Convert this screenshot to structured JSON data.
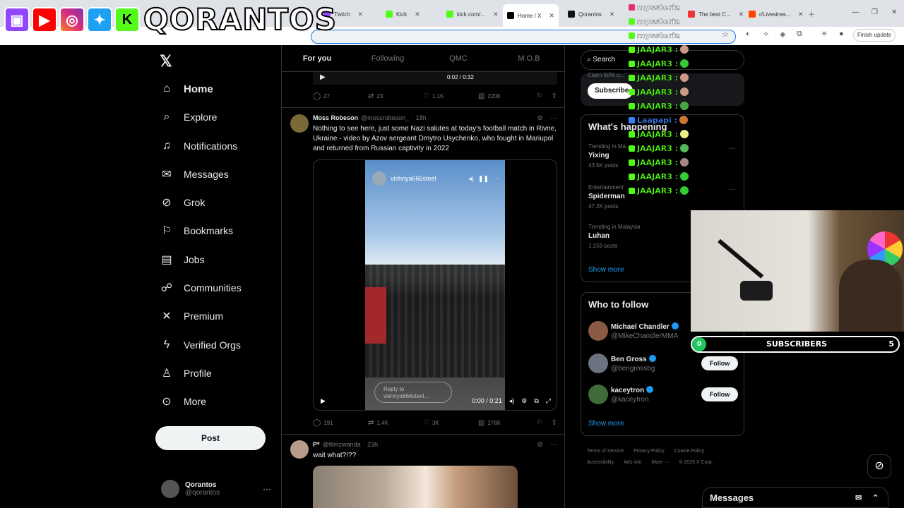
{
  "browser": {
    "tabs": [
      {
        "label": "Twitch",
        "color": "#9146ff"
      },
      {
        "label": "Kick",
        "color": "#53fc18"
      },
      {
        "label": "kick.com/...",
        "color": "#53fc18"
      },
      {
        "label": "Home / X",
        "color": "#000000",
        "active": true
      },
      {
        "label": "Qorantos",
        "color": "#111111"
      },
      {
        "label": "Instagram",
        "color": "#e1306c"
      },
      {
        "label": "The best C...",
        "color": "#e33"
      },
      {
        "label": "r/Livestrea...",
        "color": "#ff4500"
      }
    ],
    "finish_update": "Finish update"
  },
  "overlay": {
    "streamer_name": "QORANTOS",
    "logo_icons": [
      "twitch-icon",
      "youtube-icon",
      "instagram-icon",
      "twitter-icon",
      "kick-icon"
    ]
  },
  "chat": [
    {
      "user": "myssteria",
      "color": "#ffffff"
    },
    {
      "user": "myssteria",
      "color": "#ffffff"
    },
    {
      "user": "myssteria",
      "color": "#ffffff"
    },
    {
      "user": "JAAJAR3 :",
      "color": "#53fc18"
    },
    {
      "user": "JAAJAR3 :",
      "color": "#53fc18"
    },
    {
      "user": "JAAJAR3 :",
      "color": "#53fc18"
    },
    {
      "user": "JAAJAR3 :",
      "color": "#53fc18"
    },
    {
      "user": "JAAJAR3 :",
      "color": "#53fc18"
    },
    {
      "user": "Laapapi :",
      "color": "#3b82f6"
    },
    {
      "user": "JAAJAR3 :",
      "color": "#53fc18"
    },
    {
      "user": "JAAJAR3 :",
      "color": "#53fc18"
    },
    {
      "user": "JAAJAR3 :",
      "color": "#53fc18"
    },
    {
      "user": "JAAJAR3 :",
      "color": "#53fc18"
    },
    {
      "user": "JAAJAR3 :",
      "color": "#53fc18"
    }
  ],
  "nav": {
    "items": [
      {
        "label": "Home",
        "icon": "home-icon"
      },
      {
        "label": "Explore",
        "icon": "search-icon"
      },
      {
        "label": "Notifications",
        "icon": "bell-icon"
      },
      {
        "label": "Messages",
        "icon": "envelope-icon"
      },
      {
        "label": "Grok",
        "icon": "grok-icon"
      },
      {
        "label": "Bookmarks",
        "icon": "bookmark-icon"
      },
      {
        "label": "Jobs",
        "icon": "briefcase-icon"
      },
      {
        "label": "Communities",
        "icon": "people-icon"
      },
      {
        "label": "Premium",
        "icon": "x-icon"
      },
      {
        "label": "Verified Orgs",
        "icon": "lightning-icon"
      },
      {
        "label": "Profile",
        "icon": "person-icon"
      },
      {
        "label": "More",
        "icon": "more-circle-icon"
      }
    ],
    "post_label": "Post",
    "account": {
      "name": "Qorantos",
      "handle": "@qorantos"
    }
  },
  "feed": {
    "tabs": [
      "For you",
      "Following",
      "QMC",
      "M.O.B"
    ],
    "top_video_time": "0:02 / 0:32",
    "tweet0_stats": {
      "replies": "27",
      "reposts": "23",
      "likes": "1.1K",
      "views": "220K"
    },
    "tweet1": {
      "name": "Moss Robeson",
      "handle": "@mossrobeson_",
      "time": "· 18h",
      "text": "Nothing to see here, just some Nazi salutes at today's football match in Rivne, Ukraine - video by Azov sergeant Dmytro Usychenko, who fought in Mariupol and returned from Russian captivity in 2022",
      "video_user": "vishnya666steel",
      "reply_placeholder": "Reply to vishnya666steel...",
      "video_time": "0:00 / 0:21",
      "stats": {
        "replies": "191",
        "reposts": "1.4K",
        "likes": "3K",
        "views": "276K"
      }
    },
    "tweet2": {
      "name": "P*",
      "handle": "@filmzwanda",
      "time": "· 23h",
      "text": "wait what?!??"
    }
  },
  "sidebar": {
    "search_placeholder": "Search",
    "premium_text": "Claim 50% o...",
    "subscribe_label": "Subscribe",
    "happening_title": "What's happening",
    "trends": [
      {
        "category": "Trending in Ma...",
        "name": "Yixing",
        "count": "43.5K posts"
      },
      {
        "category": "Entertainment",
        "name": "Spiderman",
        "count": "47.2K posts"
      },
      {
        "category": "Trending in Malaysia",
        "name": "Luhan",
        "count": "1,159 posts"
      }
    ],
    "show_more": "Show more",
    "follow_title": "Who to follow",
    "who_to_follow": [
      {
        "name": "Michael Chandler",
        "handle": "@MikeChandlerMMA",
        "follow": "Follow",
        "avatar_color": "#8a5a44"
      },
      {
        "name": "Ben Gross",
        "handle": "@bengrossbg",
        "follow": "Follow",
        "avatar_color": "#6b7280"
      },
      {
        "name": "kaceytron",
        "handle": "@kaceytron",
        "follow": "Follow",
        "avatar_color": "#3f6b3a"
      }
    ],
    "show_more_2": "Show more",
    "footer": [
      "Terms of Service",
      "Privacy Policy",
      "Cookie Policy",
      "Accessibility",
      "Ads info",
      "More ···",
      "© 2025 X Corp."
    ],
    "messages_label": "Messages"
  },
  "stream_widgets": {
    "subscribers_label": "SUBSCRIBERS",
    "subscribers_current": "0",
    "subscribers_goal": "5",
    "subscribers_progress": 0
  }
}
